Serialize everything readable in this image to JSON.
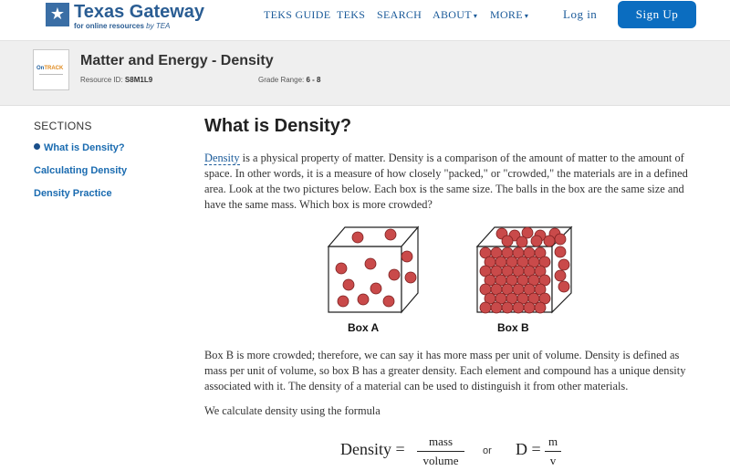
{
  "brand": {
    "title": "Texas Gateway",
    "subtitle": "for online resources",
    "subtitle_by": "by TEA",
    "star_glyph": "★"
  },
  "nav": {
    "teks_guide": "TEKS GUIDE",
    "teks": "TEKS",
    "search": "SEARCH",
    "about": "ABOUT",
    "more": "MORE",
    "caret": "▾",
    "login": "Log in",
    "signup": "Sign Up"
  },
  "resource": {
    "thumb_logo_a": "On",
    "thumb_logo_b": "TRACK",
    "title": "Matter and Energy - Density",
    "id_label": "Resource ID:",
    "id_value": "S8M1L9",
    "grade_label": "Grade Range:",
    "grade_value": "6 - 8"
  },
  "sidebar": {
    "title": "SECTIONS",
    "items": [
      {
        "label": "What is Density?",
        "active": true
      },
      {
        "label": "Calculating Density",
        "active": false
      },
      {
        "label": "Density Practice",
        "active": false
      }
    ]
  },
  "main": {
    "heading": "What is Density?",
    "p1_link": "Density",
    "p1_rest": " is a physical property of matter. Density is a comparison of the amount of matter to the amount of space. In other words, it is a measure of how closely \"packed,\" or \"crowded,\" the materials are in a defined area. Look at the two pictures below. Each box is the same size. The balls in the box are the same size and have the same mass. Which box is more crowded?",
    "box_a_label": "Box A",
    "box_b_label": "Box B",
    "p2": "Box B is more crowded; therefore, we can say it has more mass per unit of volume. Density is defined as mass per unit of volume, so box B has a greater density. Each element and compound has a unique density associated with it. The density of a material can be used to distinguish it from other materials.",
    "p3": "We calculate density using the formula",
    "formula": {
      "lhs": "Density =",
      "num": "mass",
      "den": "volume",
      "or": "or",
      "lhs2": "D =",
      "num2": "m",
      "den2": "v"
    }
  },
  "colors": {
    "brand_blue": "#2a5d93",
    "link_blue": "#1a5a99",
    "signup_bg": "#0b6dc0",
    "ball_fill": "#c94a4a",
    "ball_stroke": "#7a1f1f"
  }
}
